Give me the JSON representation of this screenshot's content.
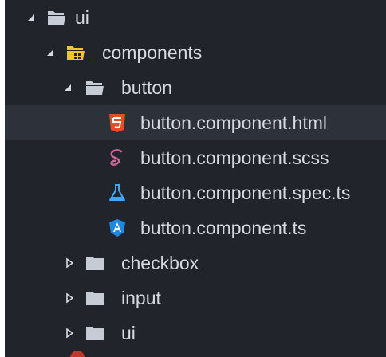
{
  "tree": {
    "root": {
      "label": "ui",
      "expanded": true,
      "icon": "folder-open-icon"
    },
    "components": {
      "label": "components",
      "expanded": true,
      "icon": "components-folder-open-icon"
    },
    "button": {
      "label": "button",
      "expanded": true,
      "icon": "folder-open-icon"
    },
    "files": [
      {
        "label": "button.component.html",
        "icon": "html5-icon",
        "color": "#e44d26",
        "selected": true
      },
      {
        "label": "button.component.scss",
        "icon": "sass-icon",
        "color": "#cd6799"
      },
      {
        "label": "button.component.spec.ts",
        "icon": "flask-icon",
        "color": "#42a5f5"
      },
      {
        "label": "button.component.ts",
        "icon": "angular-icon",
        "color": "#1e88e5"
      }
    ],
    "folders": [
      {
        "label": "checkbox",
        "expanded": false,
        "icon": "folder-icon"
      },
      {
        "label": "input",
        "expanded": false,
        "icon": "folder-icon"
      },
      {
        "label": "ui",
        "expanded": false,
        "icon": "folder-icon"
      }
    ]
  },
  "colors": {
    "background": "#21252b",
    "selected_row": "#2c313a",
    "text": "#d7dae0",
    "folder": "#c5ccd6",
    "components_folder": "#f4c430"
  }
}
